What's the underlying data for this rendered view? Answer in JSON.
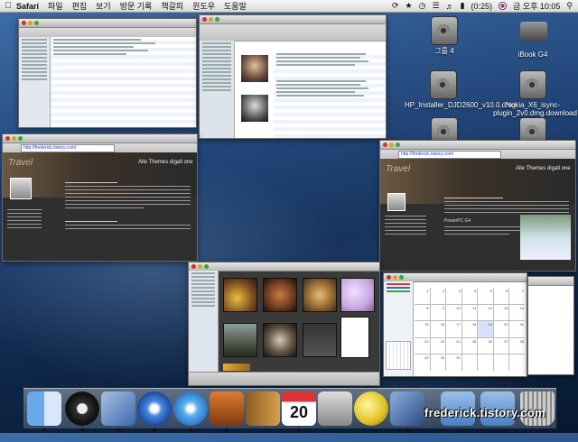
{
  "menubar": {
    "app_name": "Safari",
    "menus": [
      "파일",
      "편집",
      "보기",
      "방문 기록",
      "책갈피",
      "윈도우",
      "도움말"
    ],
    "battery": "(0:25)",
    "clock": "금 오후 10:05"
  },
  "desktop_icons": [
    {
      "label": "그룹 4",
      "kind": "dmg"
    },
    {
      "label": "iBook G4",
      "kind": "hdd"
    },
    {
      "label": "HP_Installer_DJD2600_v10.0.dmg",
      "kind": "dmg"
    },
    {
      "label": "Nokia_X6_isync-plugin_2v0.dmg.download",
      "kind": "dmg"
    }
  ],
  "windows": {
    "blog_title_left": "Alle Themes digall one",
    "blog_title_right": "Alle Themes digall one",
    "blog_banner": "Travel",
    "blog_post_right": "PowerPC G4",
    "url_left": "http://frederick.tistory.com/",
    "url_right": "http://frederick.tistory.com/"
  },
  "calendar": {
    "days": [
      "1",
      "2",
      "3",
      "4",
      "5",
      "6",
      "7",
      "8",
      "9",
      "10",
      "11",
      "12",
      "13",
      "14",
      "15",
      "16",
      "17",
      "18",
      "19",
      "20",
      "21",
      "22",
      "23",
      "24",
      "25",
      "26",
      "27",
      "28",
      "29",
      "30",
      "31",
      "",
      "",
      "",
      ""
    ]
  },
  "dock": {
    "items": [
      "finder",
      "dashboard",
      "mail",
      "safari",
      "itunes",
      "iphoto",
      "address-book",
      "ical",
      "system-preferences",
      "ichat",
      "preview",
      "applications-folder",
      "documents-folder",
      "trash"
    ],
    "ical_date": "20"
  },
  "watermark": "frederick.tistory.com",
  "colors": {
    "accent": "#2a5db0",
    "desktop": "#1c3c6a"
  }
}
